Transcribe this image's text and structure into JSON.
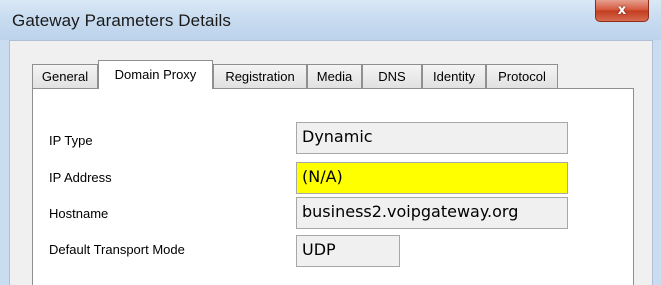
{
  "window": {
    "title": "Gateway Parameters Details",
    "close_glyph": "x",
    "close_icon": "close-icon"
  },
  "tabs": [
    {
      "label": "General",
      "active": false
    },
    {
      "label": "Domain Proxy",
      "active": true
    },
    {
      "label": "Registration",
      "active": false
    },
    {
      "label": "Media",
      "active": false
    },
    {
      "label": "DNS",
      "active": false
    },
    {
      "label": "Identity",
      "active": false
    },
    {
      "label": "Protocol",
      "active": false
    }
  ],
  "fields": {
    "ip_type": {
      "label": "IP Type",
      "value": "Dynamic"
    },
    "ip_address": {
      "label": "IP Address",
      "value": "(N/A)",
      "highlight_color": "#ffff00"
    },
    "hostname": {
      "label": "Hostname",
      "value": "business2.voipgateway.org"
    },
    "transport_mode": {
      "label": "Default Transport Mode",
      "value": "UDP"
    }
  }
}
